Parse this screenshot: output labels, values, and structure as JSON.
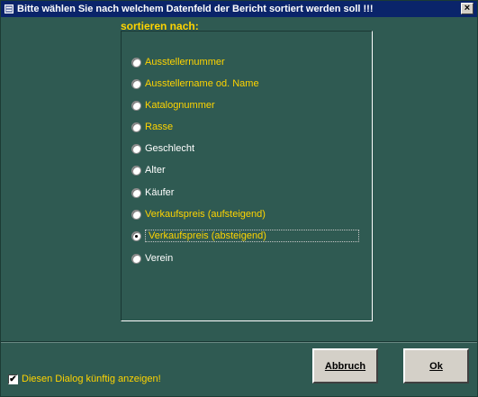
{
  "window": {
    "title": "Bitte wählen Sie nach welchem Datenfeld der Bericht sortiert werden soll !!!",
    "close_label": "×"
  },
  "group": {
    "label": "sortieren nach:",
    "options": [
      {
        "label": "Ausstellernummer",
        "checked": false,
        "color": "#ffd400"
      },
      {
        "label": "Ausstellername od. Name",
        "checked": false,
        "color": "#ffd400"
      },
      {
        "label": "Katalognummer",
        "checked": false,
        "color": "#ffd400"
      },
      {
        "label": "Rasse",
        "checked": false,
        "color": "#ffd400"
      },
      {
        "label": "Geschlecht",
        "checked": false,
        "color": "#ffffff"
      },
      {
        "label": "Alter",
        "checked": false,
        "color": "#ffffff"
      },
      {
        "label": "Käufer",
        "checked": false,
        "color": "#ffffff"
      },
      {
        "label": "Verkaufspreis (aufsteigend)",
        "checked": false,
        "color": "#ffd400"
      },
      {
        "label": "Verkaufspreis (absteigend)",
        "checked": true,
        "color": "#ffd400"
      },
      {
        "label": "Verein",
        "checked": false,
        "color": "#ffffff"
      }
    ]
  },
  "checkbox": {
    "label": "Diesen Dialog künftig anzeigen!",
    "checked": true,
    "mark": "✔"
  },
  "buttons": {
    "cancel_label": "Abbruch",
    "ok_label": "Ok"
  },
  "colors": {
    "background": "#2f5a52",
    "titlebar": "#0a246a",
    "accent_text": "#ffd400"
  }
}
